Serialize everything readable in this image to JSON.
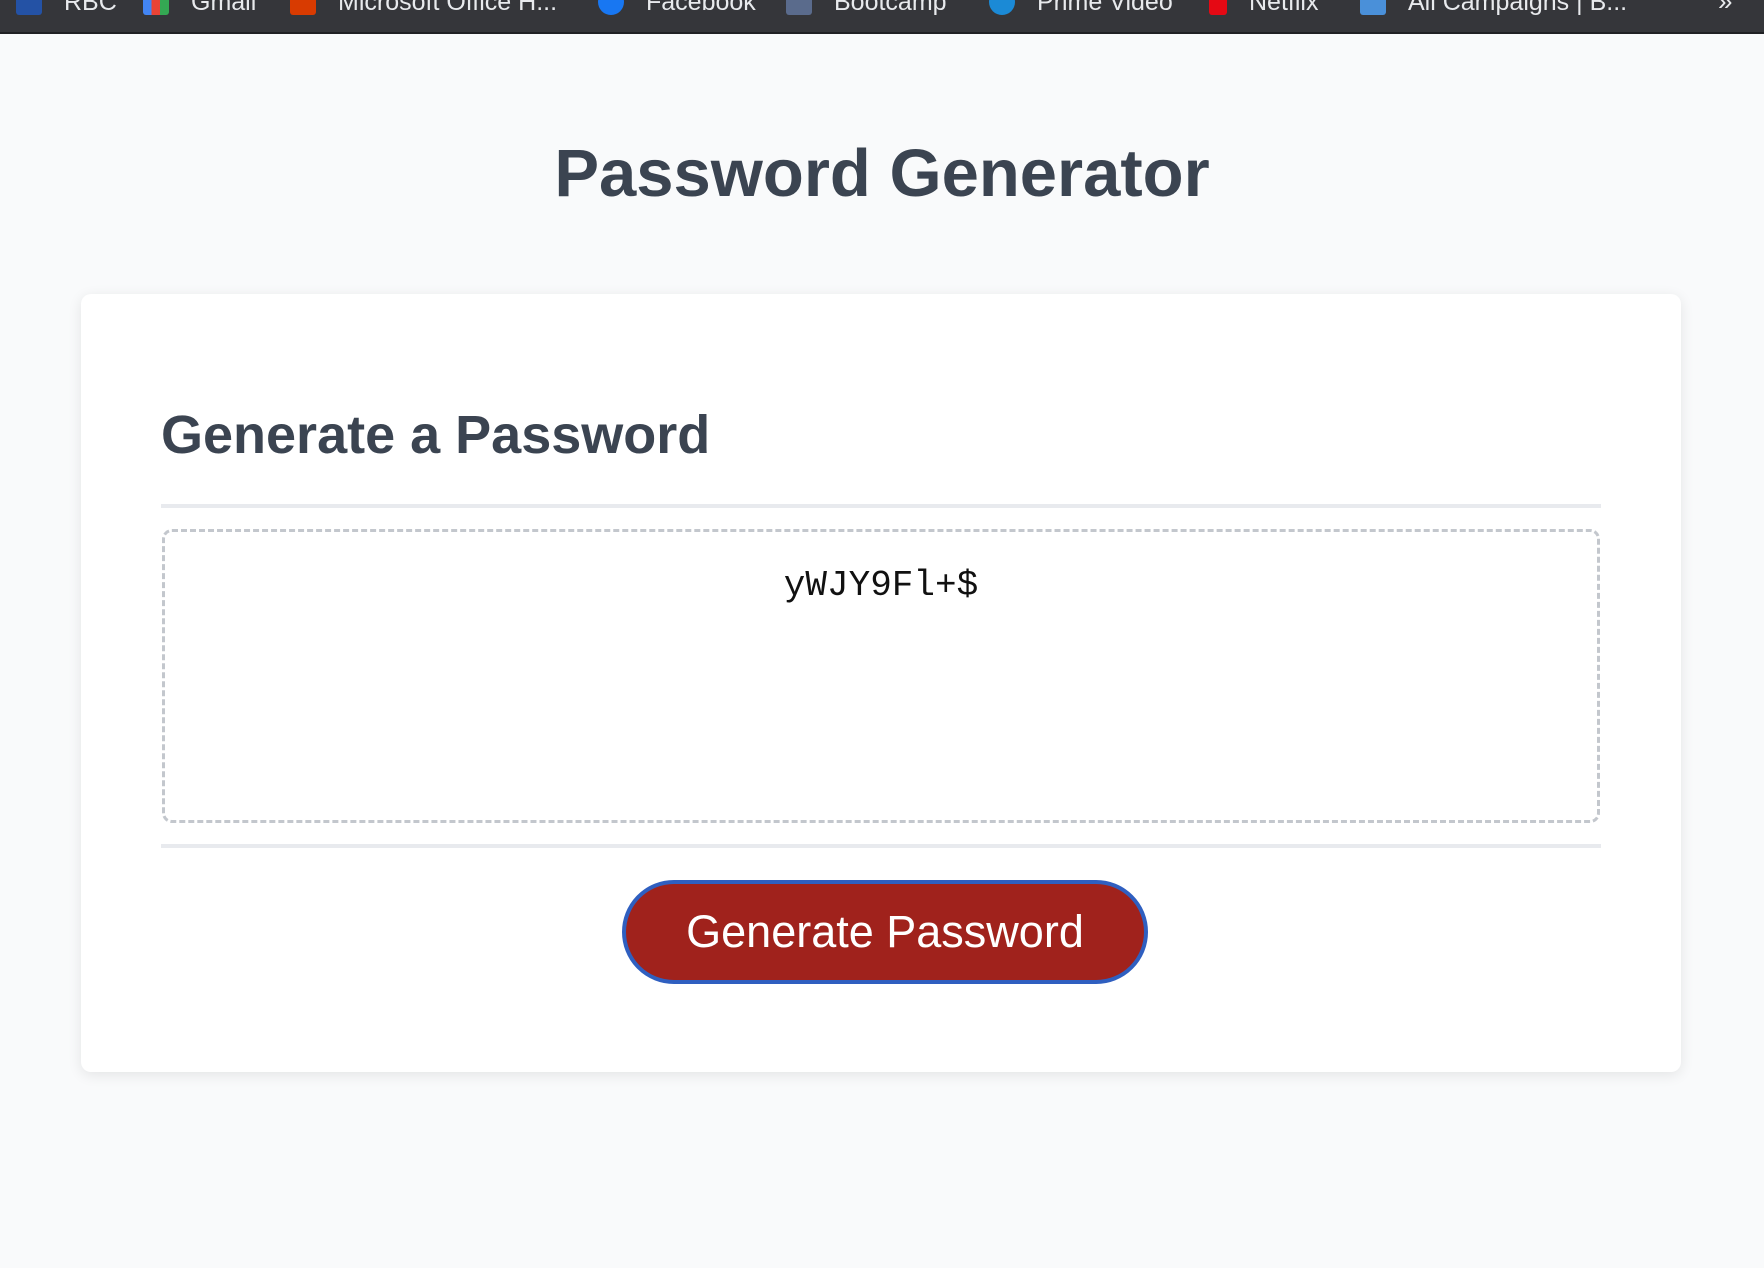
{
  "bookmarks": [
    {
      "label": "RBC",
      "icon": "rbc-icon",
      "color": "#2452a5"
    },
    {
      "label": "Gmail",
      "icon": "gmail-icon",
      "color": "#4285f4"
    },
    {
      "label": "Microsoft Office H...",
      "icon": "office-icon",
      "color": "#d83b01"
    },
    {
      "label": "Facebook",
      "icon": "facebook-icon",
      "color": "#1877f2"
    },
    {
      "label": "Bootcamp",
      "icon": "bootcamp-icon",
      "color": "#5a6b8c"
    },
    {
      "label": "Prime Video",
      "icon": "prime-video-icon",
      "color": "#1b8ad6"
    },
    {
      "label": "Netflix",
      "icon": "netflix-icon",
      "color": "#e50914"
    },
    {
      "label": "All Campaigns | B...",
      "icon": "campaigns-icon",
      "color": "#4a90d9"
    }
  ],
  "bookmarks_overflow": "»",
  "page": {
    "title": "Password Generator"
  },
  "card": {
    "header": "Generate a Password",
    "password": "yWJY9Fl+$",
    "button_label": "Generate Password"
  },
  "colors": {
    "button_bg": "#a0221c",
    "button_border": "#2f5fc0",
    "heading_text": "#3b4451",
    "page_bg": "#f9fafb"
  }
}
